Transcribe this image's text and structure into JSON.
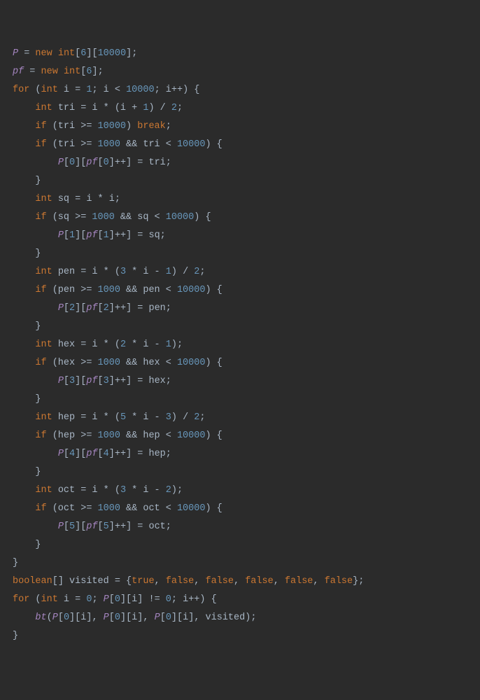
{
  "code": {
    "lines": [
      [
        {
          "t": "P",
          "c": "field"
        },
        {
          "t": " = ",
          "c": "op"
        },
        {
          "t": "new",
          "c": "kw"
        },
        {
          "t": " ",
          "c": "op"
        },
        {
          "t": "int",
          "c": "kw"
        },
        {
          "t": "[",
          "c": "punc"
        },
        {
          "t": "6",
          "c": "num"
        },
        {
          "t": "][",
          "c": "punc"
        },
        {
          "t": "10000",
          "c": "num"
        },
        {
          "t": "];",
          "c": "punc"
        }
      ],
      [
        {
          "t": "pf",
          "c": "field"
        },
        {
          "t": " = ",
          "c": "op"
        },
        {
          "t": "new",
          "c": "kw"
        },
        {
          "t": " ",
          "c": "op"
        },
        {
          "t": "int",
          "c": "kw"
        },
        {
          "t": "[",
          "c": "punc"
        },
        {
          "t": "6",
          "c": "num"
        },
        {
          "t": "];",
          "c": "punc"
        }
      ],
      [
        {
          "t": "for",
          "c": "kw"
        },
        {
          "t": " (",
          "c": "punc"
        },
        {
          "t": "int",
          "c": "kw"
        },
        {
          "t": " i = ",
          "c": "op"
        },
        {
          "t": "1",
          "c": "num"
        },
        {
          "t": "; i < ",
          "c": "op"
        },
        {
          "t": "10000",
          "c": "num"
        },
        {
          "t": "; i++) {",
          "c": "punc"
        }
      ],
      [
        {
          "t": "    ",
          "c": "op"
        },
        {
          "t": "int",
          "c": "kw"
        },
        {
          "t": " tri = i * (i + ",
          "c": "op"
        },
        {
          "t": "1",
          "c": "num"
        },
        {
          "t": ") / ",
          "c": "op"
        },
        {
          "t": "2",
          "c": "num"
        },
        {
          "t": ";",
          "c": "punc"
        }
      ],
      [
        {
          "t": "    ",
          "c": "op"
        },
        {
          "t": "if",
          "c": "kw"
        },
        {
          "t": " (tri >= ",
          "c": "op"
        },
        {
          "t": "10000",
          "c": "num"
        },
        {
          "t": ") ",
          "c": "op"
        },
        {
          "t": "break",
          "c": "kw"
        },
        {
          "t": ";",
          "c": "punc"
        }
      ],
      [
        {
          "t": "    ",
          "c": "op"
        },
        {
          "t": "if",
          "c": "kw"
        },
        {
          "t": " (tri >= ",
          "c": "op"
        },
        {
          "t": "1000",
          "c": "num"
        },
        {
          "t": " && tri < ",
          "c": "op"
        },
        {
          "t": "10000",
          "c": "num"
        },
        {
          "t": ") {",
          "c": "punc"
        }
      ],
      [
        {
          "t": "        ",
          "c": "op"
        },
        {
          "t": "P",
          "c": "field"
        },
        {
          "t": "[",
          "c": "punc"
        },
        {
          "t": "0",
          "c": "num"
        },
        {
          "t": "][",
          "c": "punc"
        },
        {
          "t": "pf",
          "c": "field"
        },
        {
          "t": "[",
          "c": "punc"
        },
        {
          "t": "0",
          "c": "num"
        },
        {
          "t": "]++] = tri;",
          "c": "punc"
        }
      ],
      [
        {
          "t": "    }",
          "c": "punc"
        }
      ],
      [
        {
          "t": "    ",
          "c": "op"
        },
        {
          "t": "int",
          "c": "kw"
        },
        {
          "t": " sq = i * i;",
          "c": "op"
        }
      ],
      [
        {
          "t": "    ",
          "c": "op"
        },
        {
          "t": "if",
          "c": "kw"
        },
        {
          "t": " (sq >= ",
          "c": "op"
        },
        {
          "t": "1000",
          "c": "num"
        },
        {
          "t": " && sq < ",
          "c": "op"
        },
        {
          "t": "10000",
          "c": "num"
        },
        {
          "t": ") {",
          "c": "punc"
        }
      ],
      [
        {
          "t": "        ",
          "c": "op"
        },
        {
          "t": "P",
          "c": "field"
        },
        {
          "t": "[",
          "c": "punc"
        },
        {
          "t": "1",
          "c": "num"
        },
        {
          "t": "][",
          "c": "punc"
        },
        {
          "t": "pf",
          "c": "field"
        },
        {
          "t": "[",
          "c": "punc"
        },
        {
          "t": "1",
          "c": "num"
        },
        {
          "t": "]++] = sq;",
          "c": "punc"
        }
      ],
      [
        {
          "t": "    }",
          "c": "punc"
        }
      ],
      [
        {
          "t": "    ",
          "c": "op"
        },
        {
          "t": "int",
          "c": "kw"
        },
        {
          "t": " pen = i * (",
          "c": "op"
        },
        {
          "t": "3",
          "c": "num"
        },
        {
          "t": " * i - ",
          "c": "op"
        },
        {
          "t": "1",
          "c": "num"
        },
        {
          "t": ") / ",
          "c": "op"
        },
        {
          "t": "2",
          "c": "num"
        },
        {
          "t": ";",
          "c": "punc"
        }
      ],
      [
        {
          "t": "    ",
          "c": "op"
        },
        {
          "t": "if",
          "c": "kw"
        },
        {
          "t": " (pen >= ",
          "c": "op"
        },
        {
          "t": "1000",
          "c": "num"
        },
        {
          "t": " && pen < ",
          "c": "op"
        },
        {
          "t": "10000",
          "c": "num"
        },
        {
          "t": ") {",
          "c": "punc"
        }
      ],
      [
        {
          "t": "        ",
          "c": "op"
        },
        {
          "t": "P",
          "c": "field"
        },
        {
          "t": "[",
          "c": "punc"
        },
        {
          "t": "2",
          "c": "num"
        },
        {
          "t": "][",
          "c": "punc"
        },
        {
          "t": "pf",
          "c": "field"
        },
        {
          "t": "[",
          "c": "punc"
        },
        {
          "t": "2",
          "c": "num"
        },
        {
          "t": "]++] = pen;",
          "c": "punc"
        }
      ],
      [
        {
          "t": "    }",
          "c": "punc"
        }
      ],
      [
        {
          "t": "    ",
          "c": "op"
        },
        {
          "t": "int",
          "c": "kw"
        },
        {
          "t": " hex = i * (",
          "c": "op"
        },
        {
          "t": "2",
          "c": "num"
        },
        {
          "t": " * i - ",
          "c": "op"
        },
        {
          "t": "1",
          "c": "num"
        },
        {
          "t": ");",
          "c": "punc"
        }
      ],
      [
        {
          "t": "    ",
          "c": "op"
        },
        {
          "t": "if",
          "c": "kw"
        },
        {
          "t": " (hex >= ",
          "c": "op"
        },
        {
          "t": "1000",
          "c": "num"
        },
        {
          "t": " && hex < ",
          "c": "op"
        },
        {
          "t": "10000",
          "c": "num"
        },
        {
          "t": ") {",
          "c": "punc"
        }
      ],
      [
        {
          "t": "        ",
          "c": "op"
        },
        {
          "t": "P",
          "c": "field"
        },
        {
          "t": "[",
          "c": "punc"
        },
        {
          "t": "3",
          "c": "num"
        },
        {
          "t": "][",
          "c": "punc"
        },
        {
          "t": "pf",
          "c": "field"
        },
        {
          "t": "[",
          "c": "punc"
        },
        {
          "t": "3",
          "c": "num"
        },
        {
          "t": "]++] = hex;",
          "c": "punc"
        }
      ],
      [
        {
          "t": "    }",
          "c": "punc"
        }
      ],
      [
        {
          "t": "    ",
          "c": "op"
        },
        {
          "t": "int",
          "c": "kw"
        },
        {
          "t": " hep = i * (",
          "c": "op"
        },
        {
          "t": "5",
          "c": "num"
        },
        {
          "t": " * i - ",
          "c": "op"
        },
        {
          "t": "3",
          "c": "num"
        },
        {
          "t": ") / ",
          "c": "op"
        },
        {
          "t": "2",
          "c": "num"
        },
        {
          "t": ";",
          "c": "punc"
        }
      ],
      [
        {
          "t": "    ",
          "c": "op"
        },
        {
          "t": "if",
          "c": "kw"
        },
        {
          "t": " (hep >= ",
          "c": "op"
        },
        {
          "t": "1000",
          "c": "num"
        },
        {
          "t": " && hep < ",
          "c": "op"
        },
        {
          "t": "10000",
          "c": "num"
        },
        {
          "t": ") {",
          "c": "punc"
        }
      ],
      [
        {
          "t": "        ",
          "c": "op"
        },
        {
          "t": "P",
          "c": "field"
        },
        {
          "t": "[",
          "c": "punc"
        },
        {
          "t": "4",
          "c": "num"
        },
        {
          "t": "][",
          "c": "punc"
        },
        {
          "t": "pf",
          "c": "field"
        },
        {
          "t": "[",
          "c": "punc"
        },
        {
          "t": "4",
          "c": "num"
        },
        {
          "t": "]++] = hep;",
          "c": "punc"
        }
      ],
      [
        {
          "t": "    }",
          "c": "punc"
        }
      ],
      [
        {
          "t": "    ",
          "c": "op"
        },
        {
          "t": "int",
          "c": "kw"
        },
        {
          "t": " oct = i * (",
          "c": "op"
        },
        {
          "t": "3",
          "c": "num"
        },
        {
          "t": " * i - ",
          "c": "op"
        },
        {
          "t": "2",
          "c": "num"
        },
        {
          "t": ");",
          "c": "punc"
        }
      ],
      [
        {
          "t": "    ",
          "c": "op"
        },
        {
          "t": "if",
          "c": "kw"
        },
        {
          "t": " (oct >= ",
          "c": "op"
        },
        {
          "t": "1000",
          "c": "num"
        },
        {
          "t": " && oct < ",
          "c": "op"
        },
        {
          "t": "10000",
          "c": "num"
        },
        {
          "t": ") {",
          "c": "punc"
        }
      ],
      [
        {
          "t": "        ",
          "c": "op"
        },
        {
          "t": "P",
          "c": "field"
        },
        {
          "t": "[",
          "c": "punc"
        },
        {
          "t": "5",
          "c": "num"
        },
        {
          "t": "][",
          "c": "punc"
        },
        {
          "t": "pf",
          "c": "field"
        },
        {
          "t": "[",
          "c": "punc"
        },
        {
          "t": "5",
          "c": "num"
        },
        {
          "t": "]++] = oct;",
          "c": "punc"
        }
      ],
      [
        {
          "t": "    }",
          "c": "punc"
        }
      ],
      [
        {
          "t": "}",
          "c": "punc"
        }
      ],
      [
        {
          "t": "boolean",
          "c": "kw"
        },
        {
          "t": "[] visited = {",
          "c": "op"
        },
        {
          "t": "true",
          "c": "kw"
        },
        {
          "t": ", ",
          "c": "op"
        },
        {
          "t": "false",
          "c": "kw"
        },
        {
          "t": ", ",
          "c": "op"
        },
        {
          "t": "false",
          "c": "kw"
        },
        {
          "t": ", ",
          "c": "op"
        },
        {
          "t": "false",
          "c": "kw"
        },
        {
          "t": ", ",
          "c": "op"
        },
        {
          "t": "false",
          "c": "kw"
        },
        {
          "t": ", ",
          "c": "op"
        },
        {
          "t": "false",
          "c": "kw"
        },
        {
          "t": "};",
          "c": "punc"
        }
      ],
      [
        {
          "t": "for",
          "c": "kw"
        },
        {
          "t": " (",
          "c": "punc"
        },
        {
          "t": "int",
          "c": "kw"
        },
        {
          "t": " i = ",
          "c": "op"
        },
        {
          "t": "0",
          "c": "num"
        },
        {
          "t": "; ",
          "c": "op"
        },
        {
          "t": "P",
          "c": "field"
        },
        {
          "t": "[",
          "c": "punc"
        },
        {
          "t": "0",
          "c": "num"
        },
        {
          "t": "][i] != ",
          "c": "op"
        },
        {
          "t": "0",
          "c": "num"
        },
        {
          "t": "; i++) {",
          "c": "punc"
        }
      ],
      [
        {
          "t": "    ",
          "c": "op"
        },
        {
          "t": "bt",
          "c": "field"
        },
        {
          "t": "(",
          "c": "punc"
        },
        {
          "t": "P",
          "c": "field"
        },
        {
          "t": "[",
          "c": "punc"
        },
        {
          "t": "0",
          "c": "num"
        },
        {
          "t": "][i], ",
          "c": "op"
        },
        {
          "t": "P",
          "c": "field"
        },
        {
          "t": "[",
          "c": "punc"
        },
        {
          "t": "0",
          "c": "num"
        },
        {
          "t": "][i], ",
          "c": "op"
        },
        {
          "t": "P",
          "c": "field"
        },
        {
          "t": "[",
          "c": "punc"
        },
        {
          "t": "0",
          "c": "num"
        },
        {
          "t": "][i], visited);",
          "c": "op"
        }
      ],
      [
        {
          "t": "}",
          "c": "punc"
        }
      ]
    ]
  }
}
